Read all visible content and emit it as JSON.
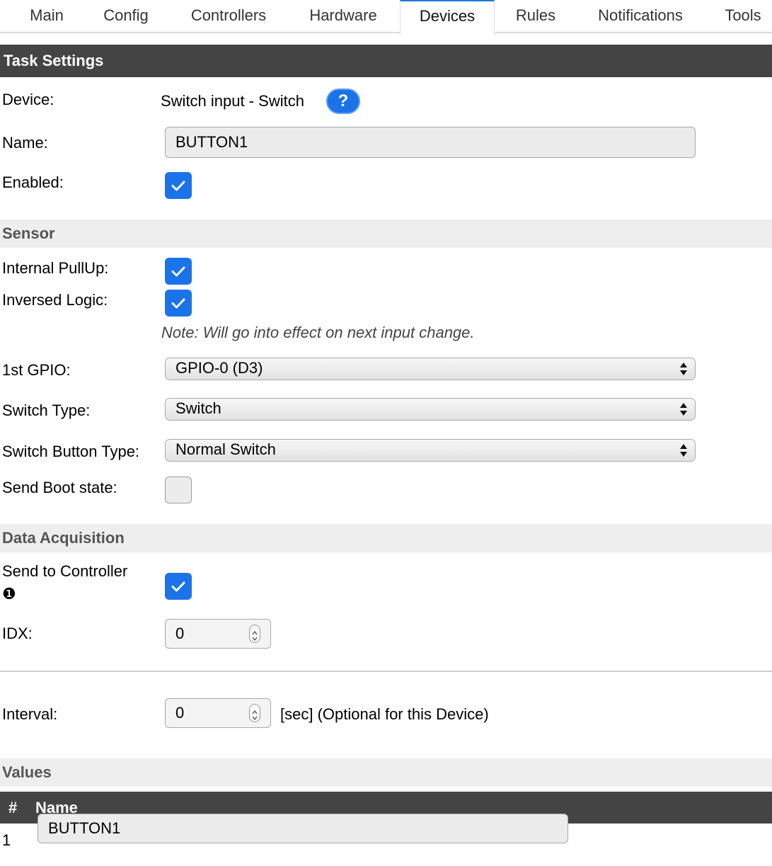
{
  "tabs": [
    {
      "label": "Main",
      "active": false
    },
    {
      "label": "Config",
      "active": false
    },
    {
      "label": "Controllers",
      "active": false
    },
    {
      "label": "Hardware",
      "active": false
    },
    {
      "label": "Devices",
      "active": true
    },
    {
      "label": "Rules",
      "active": false
    },
    {
      "label": "Notifications",
      "active": false
    },
    {
      "label": "Tools",
      "active": false
    }
  ],
  "task_settings": {
    "header": "Task Settings",
    "device_label": "Device:",
    "device_value": "Switch input - Switch",
    "help_icon": "question-icon",
    "help_glyph": "?",
    "name_label": "Name:",
    "name_value": "BUTTON1",
    "enabled_label": "Enabled:",
    "enabled": true
  },
  "sensor": {
    "header": "Sensor",
    "pullup_label": "Internal PullUp:",
    "pullup": true,
    "inversed_label": "Inversed Logic:",
    "inversed": true,
    "note": "Note: Will go into effect on next input change.",
    "gpio_label": "1st GPIO:",
    "gpio_value": "GPIO-0 (D3)",
    "switch_type_label": "Switch Type:",
    "switch_type_value": "Switch",
    "button_type_label": "Switch Button Type:",
    "button_type_value": "Normal Switch",
    "boot_state_label": "Send Boot state:",
    "boot_state": false
  },
  "data_acquisition": {
    "header": "Data Acquisition",
    "send_controller_label": "Send to Controller",
    "controller_number": "❶",
    "send_controller": true,
    "idx_label": "IDX:",
    "idx_value": "0",
    "interval_label": "Interval:",
    "interval_value": "0",
    "interval_suffix": "[sec] (Optional for this Device)"
  },
  "values": {
    "header": "Values",
    "col_hash": "#",
    "col_name": "Name",
    "rows": [
      {
        "num": "1",
        "name": "BUTTON1"
      }
    ]
  },
  "colors": {
    "accent": "#1a73e8",
    "header_dark": "#444444",
    "header_light": "#eeeeee"
  }
}
